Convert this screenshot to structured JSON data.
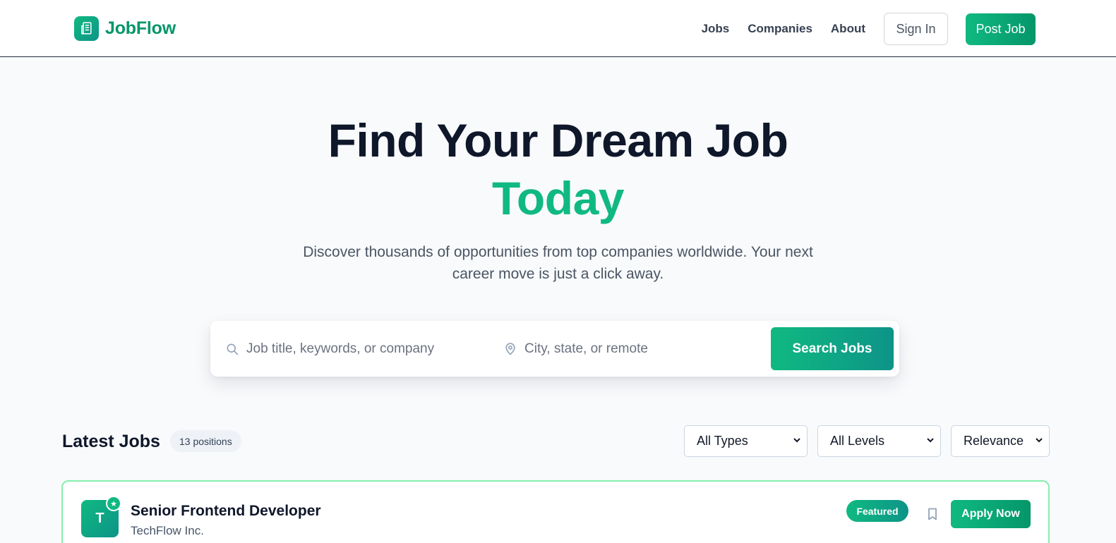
{
  "header": {
    "brand": "JobFlow",
    "nav": [
      "Jobs",
      "Companies",
      "About"
    ],
    "sign_in": "Sign In",
    "post_job": "Post Job"
  },
  "hero": {
    "title_line1": "Find Your Dream Job",
    "title_line2": "Today",
    "subtitle": "Discover thousands of opportunities from top companies worldwide. Your next career move is just a click away."
  },
  "search": {
    "keyword_placeholder": "Job title, keywords, or company",
    "location_placeholder": "City, state, or remote",
    "button": "Search Jobs"
  },
  "listing": {
    "title": "Latest Jobs",
    "count": "13 positions",
    "filters": {
      "type": "All Types",
      "level": "All Levels",
      "sort": "Relevance"
    }
  },
  "jobs": [
    {
      "initial": "T",
      "title": "Senior Frontend Developer",
      "company": "TechFlow Inc.",
      "badge": "Featured",
      "apply": "Apply Now"
    }
  ],
  "colors": {
    "brand": "#10b981",
    "brand_dark": "#059669",
    "text": "#0f172a",
    "muted": "#4b5563",
    "featured_border": "#86efac"
  },
  "icons": {
    "logo": "building-icon",
    "search": "search-icon",
    "location": "map-pin-icon",
    "featured": "star-icon",
    "save": "bookmark-icon",
    "dropdown": "chevron-down-icon"
  }
}
